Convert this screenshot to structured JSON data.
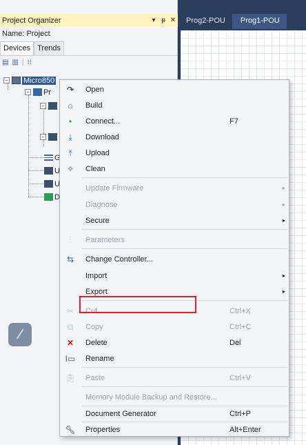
{
  "project_organizer": {
    "title": "Project Organizer",
    "controls": {
      "dropdown": "▾",
      "pin": "ᵽ",
      "close": "✕"
    },
    "name_label": "Name: Project",
    "tabs": [
      {
        "label": "Devices"
      },
      {
        "label": "Trends"
      }
    ]
  },
  "tree": {
    "root": "Micro850",
    "nodes": [
      {
        "label": "Pr"
      },
      {
        "label": "GI"
      },
      {
        "label": "U:"
      },
      {
        "label": "U:"
      },
      {
        "label": "D."
      }
    ]
  },
  "editor": {
    "tabs": [
      {
        "label": "Prog2-POU"
      },
      {
        "label": "Prog1-POU"
      }
    ]
  },
  "context_menu": {
    "items": [
      {
        "label": "Open",
        "icon": "open-icon",
        "shortcut": "",
        "disabled": false
      },
      {
        "label": "Build",
        "icon": "build-icon",
        "shortcut": "",
        "disabled": false
      },
      {
        "label": "Connect...",
        "icon": "connect-icon",
        "shortcut": "F7",
        "disabled": false
      },
      {
        "label": "Download",
        "icon": "download-icon",
        "shortcut": "",
        "disabled": false
      },
      {
        "label": "Upload",
        "icon": "upload-icon",
        "shortcut": "",
        "disabled": false
      },
      {
        "label": "Clean",
        "icon": "clean-icon",
        "shortcut": "",
        "disabled": false
      },
      {
        "label": "Update Firmware",
        "icon": "",
        "shortcut": "",
        "disabled": true,
        "submenu": true
      },
      {
        "label": "Diagnose",
        "icon": "",
        "shortcut": "",
        "disabled": true,
        "submenu": true
      },
      {
        "label": "Secure",
        "icon": "",
        "shortcut": "",
        "disabled": false,
        "submenu": true
      },
      {
        "label": "Parameters",
        "icon": "parameters-icon",
        "shortcut": "",
        "disabled": true
      },
      {
        "label": "Change Controller...",
        "icon": "change-controller-icon",
        "shortcut": "",
        "disabled": false,
        "highlighted": true
      },
      {
        "label": "Import",
        "icon": "",
        "shortcut": "",
        "disabled": false,
        "submenu": true
      },
      {
        "label": "Export",
        "icon": "",
        "shortcut": "",
        "disabled": false,
        "submenu": true
      },
      {
        "label": "Cut",
        "icon": "cut-icon",
        "shortcut": "Ctrl+X",
        "disabled": true
      },
      {
        "label": "Copy",
        "icon": "copy-icon",
        "shortcut": "Ctrl+C",
        "disabled": true
      },
      {
        "label": "Delete",
        "icon": "delete-icon",
        "shortcut": "Del",
        "disabled": false
      },
      {
        "label": "Rename",
        "icon": "rename-icon",
        "shortcut": "",
        "disabled": false
      },
      {
        "label": "Paste",
        "icon": "paste-icon",
        "shortcut": "Ctrl+V",
        "disabled": true
      },
      {
        "label": "Memory Module Backup and Restore...",
        "icon": "",
        "shortcut": "",
        "disabled": true
      },
      {
        "label": "Document Generator",
        "icon": "",
        "shortcut": "Ctrl+P",
        "disabled": false
      },
      {
        "label": "Properties",
        "icon": "properties-icon",
        "shortcut": "Alt+Enter",
        "disabled": false
      }
    ],
    "submenu_arrow": "▸",
    "highlight_color": "#e0202a"
  },
  "colors": {
    "panel_title_bg": "#fdf4bf",
    "selection_bg": "#2b5797",
    "editor_bg": "#2b3d5c"
  }
}
